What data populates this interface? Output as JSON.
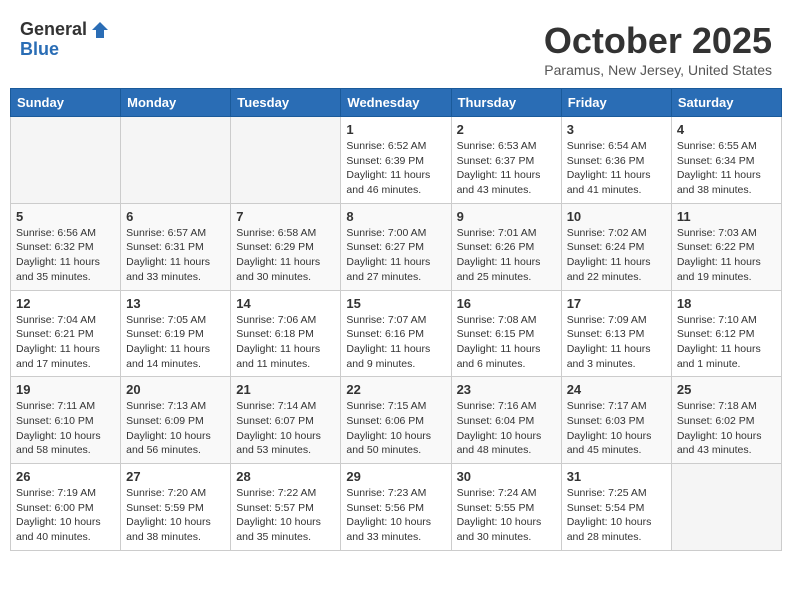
{
  "header": {
    "logo_general": "General",
    "logo_blue": "Blue",
    "month_title": "October 2025",
    "location": "Paramus, New Jersey, United States"
  },
  "weekdays": [
    "Sunday",
    "Monday",
    "Tuesday",
    "Wednesday",
    "Thursday",
    "Friday",
    "Saturday"
  ],
  "weeks": [
    [
      {
        "day": "",
        "info": ""
      },
      {
        "day": "",
        "info": ""
      },
      {
        "day": "",
        "info": ""
      },
      {
        "day": "1",
        "info": "Sunrise: 6:52 AM\nSunset: 6:39 PM\nDaylight: 11 hours\nand 46 minutes."
      },
      {
        "day": "2",
        "info": "Sunrise: 6:53 AM\nSunset: 6:37 PM\nDaylight: 11 hours\nand 43 minutes."
      },
      {
        "day": "3",
        "info": "Sunrise: 6:54 AM\nSunset: 6:36 PM\nDaylight: 11 hours\nand 41 minutes."
      },
      {
        "day": "4",
        "info": "Sunrise: 6:55 AM\nSunset: 6:34 PM\nDaylight: 11 hours\nand 38 minutes."
      }
    ],
    [
      {
        "day": "5",
        "info": "Sunrise: 6:56 AM\nSunset: 6:32 PM\nDaylight: 11 hours\nand 35 minutes."
      },
      {
        "day": "6",
        "info": "Sunrise: 6:57 AM\nSunset: 6:31 PM\nDaylight: 11 hours\nand 33 minutes."
      },
      {
        "day": "7",
        "info": "Sunrise: 6:58 AM\nSunset: 6:29 PM\nDaylight: 11 hours\nand 30 minutes."
      },
      {
        "day": "8",
        "info": "Sunrise: 7:00 AM\nSunset: 6:27 PM\nDaylight: 11 hours\nand 27 minutes."
      },
      {
        "day": "9",
        "info": "Sunrise: 7:01 AM\nSunset: 6:26 PM\nDaylight: 11 hours\nand 25 minutes."
      },
      {
        "day": "10",
        "info": "Sunrise: 7:02 AM\nSunset: 6:24 PM\nDaylight: 11 hours\nand 22 minutes."
      },
      {
        "day": "11",
        "info": "Sunrise: 7:03 AM\nSunset: 6:22 PM\nDaylight: 11 hours\nand 19 minutes."
      }
    ],
    [
      {
        "day": "12",
        "info": "Sunrise: 7:04 AM\nSunset: 6:21 PM\nDaylight: 11 hours\nand 17 minutes."
      },
      {
        "day": "13",
        "info": "Sunrise: 7:05 AM\nSunset: 6:19 PM\nDaylight: 11 hours\nand 14 minutes."
      },
      {
        "day": "14",
        "info": "Sunrise: 7:06 AM\nSunset: 6:18 PM\nDaylight: 11 hours\nand 11 minutes."
      },
      {
        "day": "15",
        "info": "Sunrise: 7:07 AM\nSunset: 6:16 PM\nDaylight: 11 hours\nand 9 minutes."
      },
      {
        "day": "16",
        "info": "Sunrise: 7:08 AM\nSunset: 6:15 PM\nDaylight: 11 hours\nand 6 minutes."
      },
      {
        "day": "17",
        "info": "Sunrise: 7:09 AM\nSunset: 6:13 PM\nDaylight: 11 hours\nand 3 minutes."
      },
      {
        "day": "18",
        "info": "Sunrise: 7:10 AM\nSunset: 6:12 PM\nDaylight: 11 hours\nand 1 minute."
      }
    ],
    [
      {
        "day": "19",
        "info": "Sunrise: 7:11 AM\nSunset: 6:10 PM\nDaylight: 10 hours\nand 58 minutes."
      },
      {
        "day": "20",
        "info": "Sunrise: 7:13 AM\nSunset: 6:09 PM\nDaylight: 10 hours\nand 56 minutes."
      },
      {
        "day": "21",
        "info": "Sunrise: 7:14 AM\nSunset: 6:07 PM\nDaylight: 10 hours\nand 53 minutes."
      },
      {
        "day": "22",
        "info": "Sunrise: 7:15 AM\nSunset: 6:06 PM\nDaylight: 10 hours\nand 50 minutes."
      },
      {
        "day": "23",
        "info": "Sunrise: 7:16 AM\nSunset: 6:04 PM\nDaylight: 10 hours\nand 48 minutes."
      },
      {
        "day": "24",
        "info": "Sunrise: 7:17 AM\nSunset: 6:03 PM\nDaylight: 10 hours\nand 45 minutes."
      },
      {
        "day": "25",
        "info": "Sunrise: 7:18 AM\nSunset: 6:02 PM\nDaylight: 10 hours\nand 43 minutes."
      }
    ],
    [
      {
        "day": "26",
        "info": "Sunrise: 7:19 AM\nSunset: 6:00 PM\nDaylight: 10 hours\nand 40 minutes."
      },
      {
        "day": "27",
        "info": "Sunrise: 7:20 AM\nSunset: 5:59 PM\nDaylight: 10 hours\nand 38 minutes."
      },
      {
        "day": "28",
        "info": "Sunrise: 7:22 AM\nSunset: 5:57 PM\nDaylight: 10 hours\nand 35 minutes."
      },
      {
        "day": "29",
        "info": "Sunrise: 7:23 AM\nSunset: 5:56 PM\nDaylight: 10 hours\nand 33 minutes."
      },
      {
        "day": "30",
        "info": "Sunrise: 7:24 AM\nSunset: 5:55 PM\nDaylight: 10 hours\nand 30 minutes."
      },
      {
        "day": "31",
        "info": "Sunrise: 7:25 AM\nSunset: 5:54 PM\nDaylight: 10 hours\nand 28 minutes."
      },
      {
        "day": "",
        "info": ""
      }
    ]
  ]
}
